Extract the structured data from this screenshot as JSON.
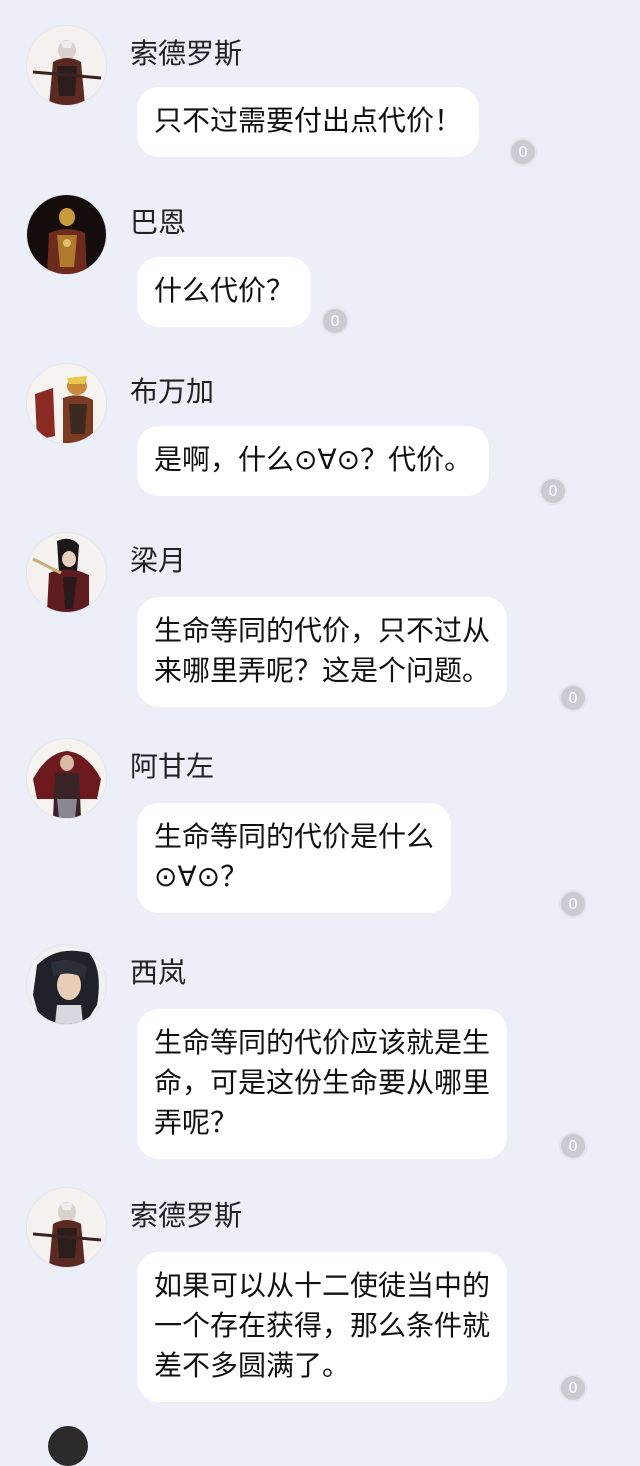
{
  "messages": [
    {
      "sender": "索德罗斯",
      "avatar_icon": "sodros-avatar-icon",
      "lines": [
        "只不过需要付出点代价！"
      ],
      "read_count": "0"
    },
    {
      "sender": "巴恩",
      "avatar_icon": "barn-avatar-icon",
      "lines": [
        "什么代价？"
      ],
      "read_count": "0"
    },
    {
      "sender": "布万加",
      "avatar_icon": "buwanga-avatar-icon",
      "lines": [
        "是啊，什么⊙∀⊙？代价。"
      ],
      "read_count": "0"
    },
    {
      "sender": "梁月",
      "avatar_icon": "liangyue-avatar-icon",
      "lines": [
        "生命等同的代价，只不过从",
        "来哪里弄呢？这是个问题。"
      ],
      "read_count": "0"
    },
    {
      "sender": "阿甘左",
      "avatar_icon": "agonzo-avatar-icon",
      "lines": [
        "生命等同的代价是什么",
        "⊙∀⊙？"
      ],
      "read_count": "0"
    },
    {
      "sender": "西岚",
      "avatar_icon": "siran-avatar-icon",
      "lines": [
        "生命等同的代价应该就是生",
        "命，可是这份生命要从哪里",
        "弄呢？"
      ],
      "read_count": "0"
    },
    {
      "sender": "索德罗斯",
      "avatar_icon": "sodros-avatar-icon",
      "lines": [
        "如果可以从十二使徒当中的",
        "一个存在获得，那么条件就",
        "差不多圆满了。"
      ],
      "read_count": "0"
    }
  ]
}
